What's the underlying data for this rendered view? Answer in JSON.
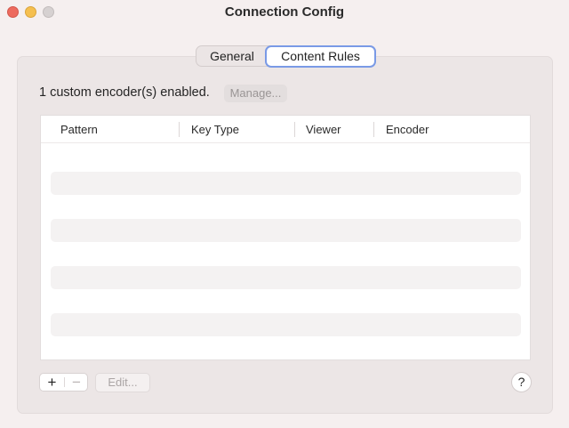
{
  "window": {
    "title": "Connection Config"
  },
  "tabs": [
    {
      "label": "General",
      "selected": false
    },
    {
      "label": "Content Rules",
      "selected": true
    }
  ],
  "status": {
    "text": "1 custom encoder(s) enabled.",
    "manage_label": "Manage..."
  },
  "table": {
    "columns": [
      "Pattern",
      "Key Type",
      "Viewer",
      "Encoder"
    ],
    "rows": []
  },
  "footer": {
    "add_label": "+",
    "remove_label": "−",
    "edit_label": "Edit...",
    "help_label": "?"
  },
  "colors": {
    "close": "#ed6a5e",
    "minimize": "#f5bf4f",
    "zoom_disabled": "#d6d1d1",
    "focus_ring": "#7a9ae6"
  }
}
